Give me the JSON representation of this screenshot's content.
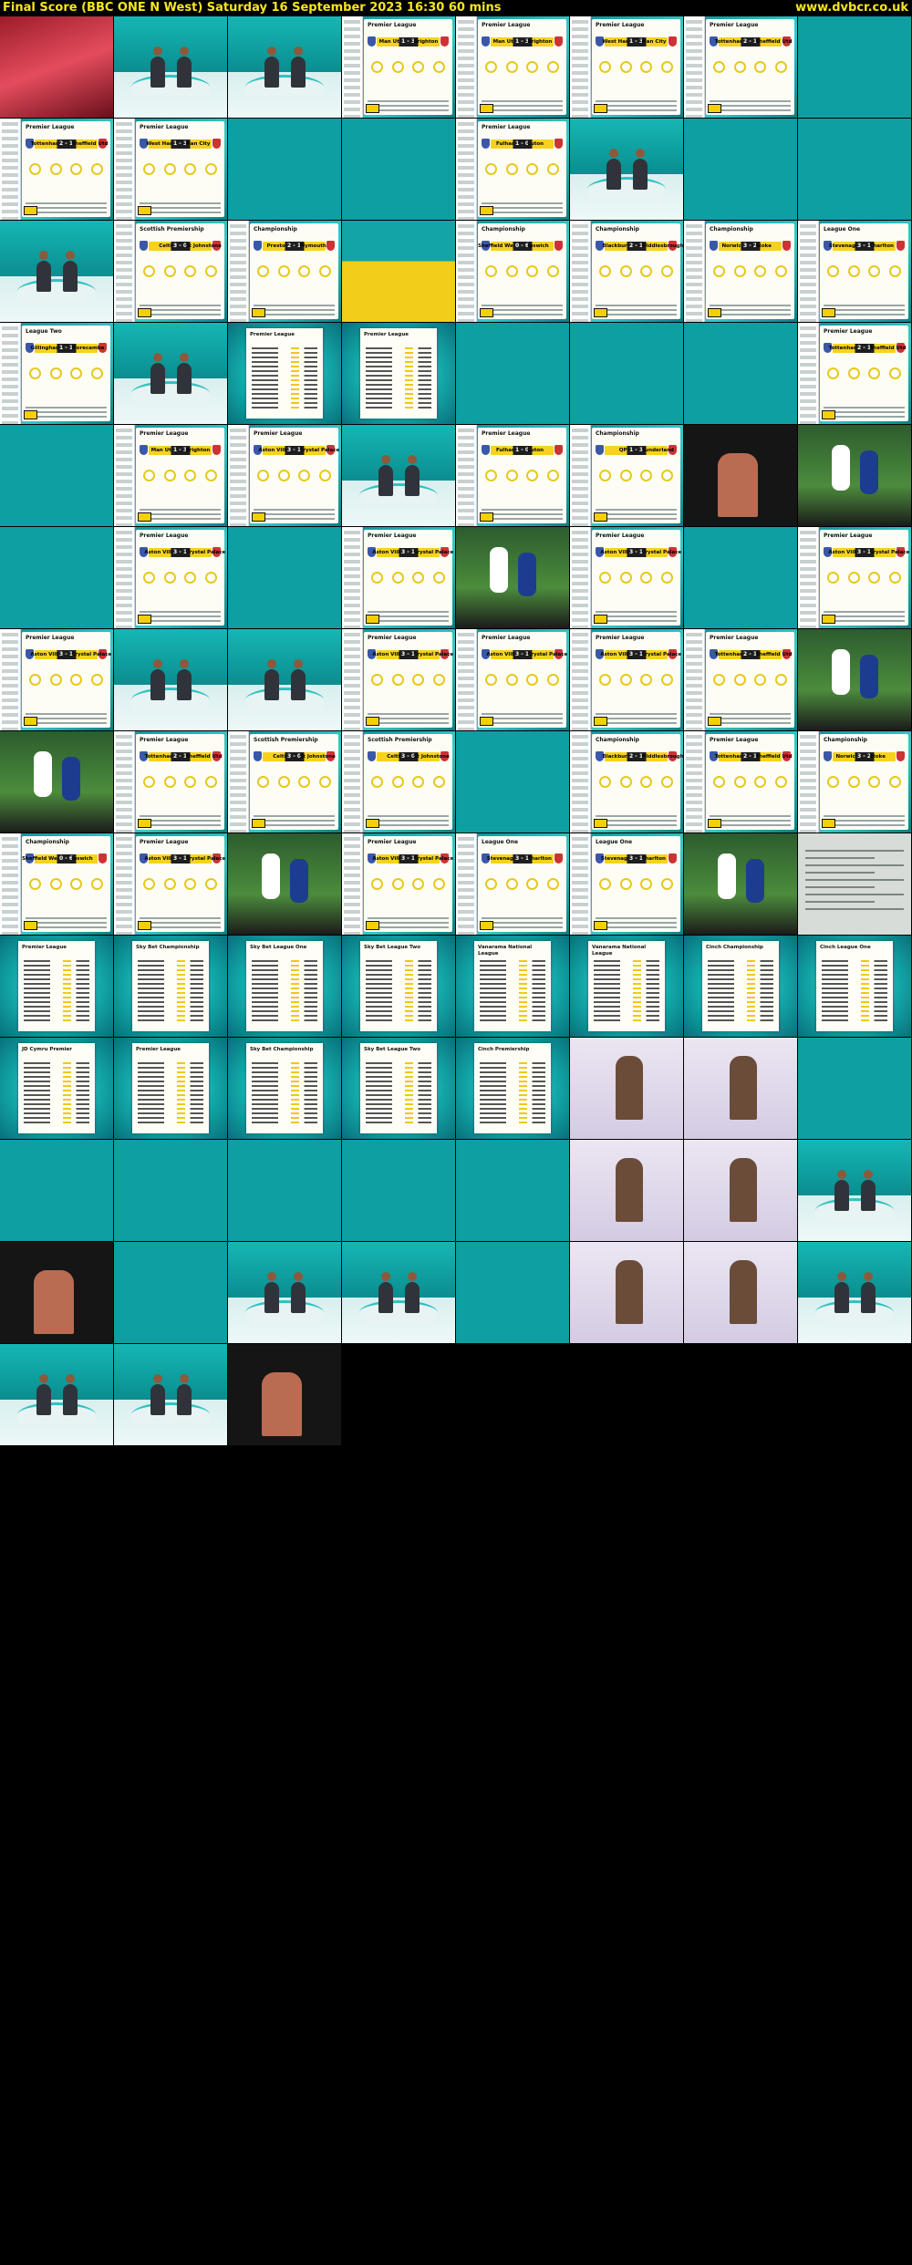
{
  "header": {
    "title": "Final Score (BBC ONE N West)   Saturday 16 September 2023  16:30  60 mins",
    "site": "www.dvbcr.co.uk"
  },
  "colors": {
    "header_bg": "#000000",
    "header_text": "#f5e61e",
    "studio_teal": "#0e9fa2",
    "accent_yellow": "#f5d000"
  },
  "tiles": [
    {
      "kind": "red"
    },
    {
      "kind": "studio"
    },
    {
      "kind": "studio"
    },
    {
      "kind": "score",
      "competition": "Premier League",
      "home": "Man Utd",
      "away": "Brighton",
      "score": "1 - 3"
    },
    {
      "kind": "score",
      "competition": "Premier League",
      "home": "Man Utd",
      "away": "Brighton",
      "score": "1 - 3"
    },
    {
      "kind": "score",
      "competition": "Premier League",
      "home": "West Ham",
      "away": "Man City",
      "score": "1 - 3"
    },
    {
      "kind": "score",
      "competition": "Premier League",
      "home": "Tottenham",
      "away": "Sheffield Utd",
      "score": "2 - 1"
    },
    {
      "kind": "presenter"
    },
    {
      "kind": "score",
      "competition": "Premier League",
      "home": "Tottenham",
      "away": "Sheffield Utd",
      "score": "2 - 1"
    },
    {
      "kind": "score",
      "competition": "Premier League",
      "home": "West Ham",
      "away": "Man City",
      "score": "1 - 3"
    },
    {
      "kind": "presenter"
    },
    {
      "kind": "presenter"
    },
    {
      "kind": "score",
      "competition": "Premier League",
      "home": "Fulham",
      "away": "Luton",
      "score": "1 - 0"
    },
    {
      "kind": "studio"
    },
    {
      "kind": "presenter"
    },
    {
      "kind": "presenter"
    },
    {
      "kind": "studio"
    },
    {
      "kind": "score",
      "competition": "Scottish Premiership",
      "home": "Celtic",
      "away": "St Johnstone",
      "score": "3 - 0"
    },
    {
      "kind": "score",
      "competition": "Championship",
      "home": "Preston",
      "away": "Plymouth",
      "score": "2 - 1"
    },
    {
      "kind": "yellow"
    },
    {
      "kind": "score",
      "competition": "Championship",
      "home": "Sheffield Wed",
      "away": "Ipswich",
      "score": "0 - 6"
    },
    {
      "kind": "score",
      "competition": "Championship",
      "home": "Blackburn",
      "away": "Middlesbrough",
      "score": "2 - 1"
    },
    {
      "kind": "score",
      "competition": "Championship",
      "home": "Norwich",
      "away": "Stoke",
      "score": "3 - 2"
    },
    {
      "kind": "score",
      "competition": "League One",
      "home": "Stevenage",
      "away": "Charlton",
      "score": "3 - 1"
    },
    {
      "kind": "score",
      "competition": "League Two",
      "home": "Gillingham",
      "away": "Morecambe",
      "score": "1 - 1"
    },
    {
      "kind": "studio"
    },
    {
      "kind": "table",
      "heading": "Premier League"
    },
    {
      "kind": "table",
      "heading": "Premier League"
    },
    {
      "kind": "presenter"
    },
    {
      "kind": "presenter"
    },
    {
      "kind": "presenter"
    },
    {
      "kind": "score",
      "competition": "Premier League",
      "home": "Tottenham",
      "away": "Sheffield Utd",
      "score": "2 - 1"
    },
    {
      "kind": "presenter"
    },
    {
      "kind": "score",
      "competition": "Premier League",
      "home": "Man Utd",
      "away": "Brighton",
      "score": "1 - 3"
    },
    {
      "kind": "score",
      "competition": "Premier League",
      "home": "Aston Villa",
      "away": "Crystal Palace",
      "score": "3 - 1"
    },
    {
      "kind": "studio"
    },
    {
      "kind": "score",
      "competition": "Premier League",
      "home": "Fulham",
      "away": "Luton",
      "score": "1 - 0"
    },
    {
      "kind": "score",
      "competition": "Championship",
      "home": "QPR",
      "away": "Sunderland",
      "score": "1 - 3"
    },
    {
      "kind": "dark"
    },
    {
      "kind": "action"
    },
    {
      "kind": "presenter"
    },
    {
      "kind": "score",
      "competition": "Premier League",
      "home": "Aston Villa",
      "away": "Crystal Palace",
      "score": "3 - 1"
    },
    {
      "kind": "presenter"
    },
    {
      "kind": "score",
      "competition": "Premier League",
      "home": "Aston Villa",
      "away": "Crystal Palace",
      "score": "3 - 1"
    },
    {
      "kind": "action"
    },
    {
      "kind": "score",
      "competition": "Premier League",
      "home": "Aston Villa",
      "away": "Crystal Palace",
      "score": "3 - 1"
    },
    {
      "kind": "presenter"
    },
    {
      "kind": "score",
      "competition": "Premier League",
      "home": "Aston Villa",
      "away": "Crystal Palace",
      "score": "3 - 1"
    },
    {
      "kind": "score",
      "competition": "Premier League",
      "home": "Aston Villa",
      "away": "Crystal Palace",
      "score": "3 - 1"
    },
    {
      "kind": "studio"
    },
    {
      "kind": "studio"
    },
    {
      "kind": "score",
      "competition": "Premier League",
      "home": "Aston Villa",
      "away": "Crystal Palace",
      "score": "3 - 1"
    },
    {
      "kind": "score",
      "competition": "Premier League",
      "home": "Aston Villa",
      "away": "Crystal Palace",
      "score": "3 - 1"
    },
    {
      "kind": "score",
      "competition": "Premier League",
      "home": "Aston Villa",
      "away": "Crystal Palace",
      "score": "3 - 1"
    },
    {
      "kind": "score",
      "competition": "Premier League",
      "home": "Tottenham",
      "away": "Sheffield Utd",
      "score": "2 - 1"
    },
    {
      "kind": "action"
    },
    {
      "kind": "action"
    },
    {
      "kind": "score",
      "competition": "Premier League",
      "home": "Tottenham",
      "away": "Sheffield Utd",
      "score": "2 - 1"
    },
    {
      "kind": "score",
      "competition": "Scottish Premiership",
      "home": "Celtic",
      "away": "St Johnstone",
      "score": "3 - 0"
    },
    {
      "kind": "score",
      "competition": "Scottish Premiership",
      "home": "Celtic",
      "away": "St Johnstone",
      "score": "3 - 0"
    },
    {
      "kind": "presenter"
    },
    {
      "kind": "score",
      "competition": "Championship",
      "home": "Blackburn",
      "away": "Middlesbrough",
      "score": "2 - 1"
    },
    {
      "kind": "score",
      "competition": "Premier League",
      "home": "Tottenham",
      "away": "Sheffield Utd",
      "score": "2 - 1"
    },
    {
      "kind": "score",
      "competition": "Championship",
      "home": "Norwich",
      "away": "Stoke",
      "score": "3 - 2"
    },
    {
      "kind": "score",
      "competition": "Championship",
      "home": "Sheffield Wed",
      "away": "Ipswich",
      "score": "0 - 6"
    },
    {
      "kind": "score",
      "competition": "Premier League",
      "home": "Aston Villa",
      "away": "Crystal Palace",
      "score": "3 - 1"
    },
    {
      "kind": "action"
    },
    {
      "kind": "score",
      "competition": "Premier League",
      "home": "Aston Villa",
      "away": "Crystal Palace",
      "score": "3 - 1"
    },
    {
      "kind": "score",
      "competition": "League One",
      "home": "Stevenage",
      "away": "Charlton",
      "score": "3 - 1"
    },
    {
      "kind": "score",
      "competition": "League One",
      "home": "Stevenage",
      "away": "Charlton",
      "score": "3 - 1"
    },
    {
      "kind": "action"
    },
    {
      "kind": "paper"
    },
    {
      "kind": "table",
      "heading": "Premier League"
    },
    {
      "kind": "table",
      "heading": "Sky Bet Championship"
    },
    {
      "kind": "table",
      "heading": "Sky Bet League One"
    },
    {
      "kind": "table",
      "heading": "Sky Bet League Two"
    },
    {
      "kind": "table",
      "heading": "Vanarama National League"
    },
    {
      "kind": "table",
      "heading": "Vanarama National League"
    },
    {
      "kind": "table",
      "heading": "Cinch Championship"
    },
    {
      "kind": "table",
      "heading": "Cinch League One"
    },
    {
      "kind": "table",
      "heading": "JD Cymru Premier"
    },
    {
      "kind": "table",
      "heading": "Premier League"
    },
    {
      "kind": "table",
      "heading": "Sky Bet Championship"
    },
    {
      "kind": "table",
      "heading": "Sky Bet League Two"
    },
    {
      "kind": "table",
      "heading": "Cinch Premiership"
    },
    {
      "kind": "lilac"
    },
    {
      "kind": "lilac"
    },
    {
      "kind": "interview"
    },
    {
      "kind": "interview"
    },
    {
      "kind": "interview"
    },
    {
      "kind": "interview"
    },
    {
      "kind": "presenter"
    },
    {
      "kind": "interview"
    },
    {
      "kind": "lilac"
    },
    {
      "kind": "lilac"
    },
    {
      "kind": "studio"
    },
    {
      "kind": "dark"
    },
    {
      "kind": "presenter"
    },
    {
      "kind": "studio"
    },
    {
      "kind": "studio"
    },
    {
      "kind": "presenter"
    },
    {
      "kind": "lilac"
    },
    {
      "kind": "lilac"
    },
    {
      "kind": "studio"
    },
    {
      "kind": "studio"
    },
    {
      "kind": "studio"
    },
    {
      "kind": "dark"
    }
  ]
}
